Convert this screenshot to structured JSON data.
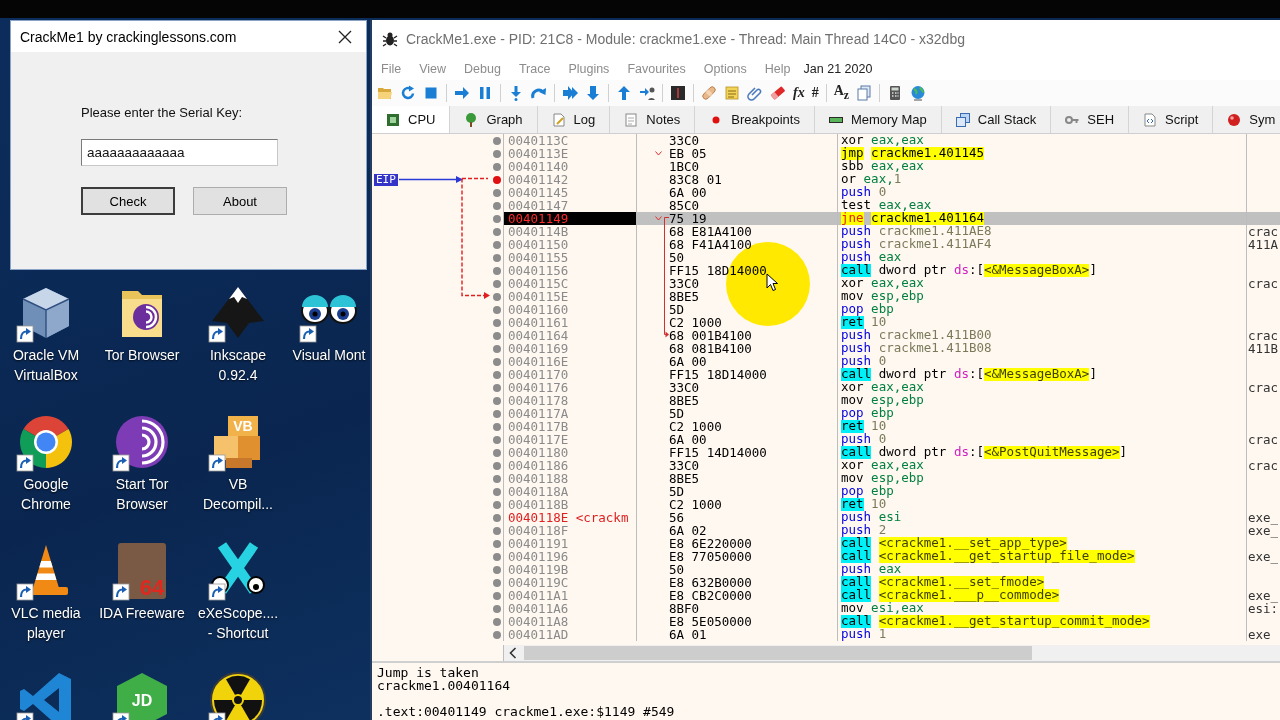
{
  "dialog": {
    "title": "CrackMe1 by crackinglessons.com",
    "prompt": "Please enter the Serial Key:",
    "serial_value": "aaaaaaaaaaaaa",
    "buttons": [
      {
        "label": "Check",
        "default": true
      },
      {
        "label": "About",
        "default": false
      }
    ]
  },
  "desktop": {
    "icon_rows": [
      [
        {
          "kind": "cube",
          "label": "Oracle VM VirtualBox",
          "shortcut": true
        },
        {
          "kind": "folder",
          "label": "Tor Browser",
          "shortcut": false
        },
        {
          "kind": "mountain",
          "label": "Inkscape 0.92.4",
          "shortcut": true
        },
        {
          "kind": "eyes",
          "label": "Visual Mont",
          "shortcut": true
        }
      ],
      [
        {
          "kind": "tricolor",
          "label": "Google Chrome",
          "shortcut": true
        },
        {
          "kind": "onion",
          "label": "Start Tor Browser",
          "shortcut": true
        },
        {
          "kind": "boxes",
          "glyph": "VB",
          "label": "VB Decompil...",
          "shortcut": true
        }
      ],
      [
        {
          "kind": "cone",
          "label": "VLC media player",
          "shortcut": true
        },
        {
          "kind": "portrait",
          "glyph": "64",
          "label": "IDA Freeware",
          "shortcut": true
        },
        {
          "kind": "xeyes",
          "label": "eXeScope.... - Shortcut",
          "shortcut": true
        }
      ],
      [
        {
          "kind": "ribbon",
          "shortcut": true
        },
        {
          "kind": "hexagon",
          "glyph": "JD",
          "shortcut": true
        },
        {
          "kind": "radiation",
          "shortcut": true
        }
      ]
    ]
  },
  "debugger": {
    "title": "CrackMe1.exe - PID: 21C8 - Module: crackme1.exe - Thread: Main Thread 14C0 - x32dbg",
    "menu": [
      "File",
      "View",
      "Debug",
      "Trace",
      "Plugins",
      "Favourites",
      "Options",
      "Help"
    ],
    "build_date": "Jan 21 2020",
    "toolbar_glyphs": [
      "fx",
      "#",
      "A$_{z}$"
    ],
    "tabs": [
      {
        "label": "CPU",
        "selected": true
      },
      {
        "label": "Graph",
        "selected": false
      },
      {
        "label": "Log",
        "selected": false
      },
      {
        "label": "Notes",
        "selected": false
      },
      {
        "label": "Breakpoints",
        "selected": false
      },
      {
        "label": "Memory Map",
        "selected": false
      },
      {
        "label": "Call Stack",
        "selected": false
      },
      {
        "label": "SEH",
        "selected": false
      },
      {
        "label": "Script",
        "selected": false
      },
      {
        "label": "Sym",
        "selected": false
      }
    ],
    "disassembly": {
      "eip_label": "EIP",
      "rows": [
        {
          "address": "0040113C",
          "bytes": "33C0",
          "mnemonic": {
            "text": "xor",
            "kind": "plain"
          },
          "operands": [
            {
              "text": "eax,eax",
              "kind": "register"
            }
          ],
          "selected": false,
          "breakpoint": false,
          "eip": false,
          "jump_marker": false
        },
        {
          "address": "0040113E",
          "bytes": "EB 05",
          "mnemonic": {
            "text": "jmp",
            "kind": "jump"
          },
          "operands": [
            {
              "text": "crackme1.401145",
              "kind": "target"
            }
          ],
          "selected": false,
          "breakpoint": false,
          "eip": false,
          "jump_marker": true
        },
        {
          "address": "00401140",
          "bytes": "1BC0",
          "mnemonic": {
            "text": "sbb",
            "kind": "plain"
          },
          "operands": [
            {
              "text": "eax,eax",
              "kind": "register"
            }
          ],
          "selected": false,
          "breakpoint": false,
          "eip": false,
          "jump_marker": false
        },
        {
          "address": "00401142",
          "bytes": "83C8 01",
          "mnemonic": {
            "text": "or",
            "kind": "plain"
          },
          "operands": [
            {
              "text": "eax,",
              "kind": "register"
            },
            {
              "text": "1",
              "kind": "value"
            }
          ],
          "selected": false,
          "breakpoint": true,
          "eip": true,
          "jump_marker": false
        },
        {
          "address": "00401145",
          "bytes": "6A 00",
          "mnemonic": {
            "text": "push",
            "kind": "stack"
          },
          "operands": [
            {
              "text": "0",
              "kind": "value"
            }
          ],
          "selected": false,
          "breakpoint": false,
          "eip": false,
          "jump_marker": false
        },
        {
          "address": "00401147",
          "bytes": "85C0",
          "mnemonic": {
            "text": "test",
            "kind": "plain"
          },
          "operands": [
            {
              "text": "eax,eax",
              "kind": "register"
            }
          ],
          "selected": false,
          "breakpoint": false,
          "eip": false,
          "jump_marker": false
        },
        {
          "address": "00401149",
          "bytes": "75 19",
          "mnemonic": {
            "text": "jne",
            "kind": "cond-jump"
          },
          "operands": [
            {
              "text": "crackme1.401164",
              "kind": "target"
            }
          ],
          "selected": true,
          "breakpoint": false,
          "eip": false,
          "jump_marker": true
        },
        {
          "address": "0040114B",
          "bytes": "68 E81A4100",
          "mnemonic": {
            "text": "push",
            "kind": "stack"
          },
          "operands": [
            {
              "text": "crackme1.411AE8",
              "kind": "value"
            }
          ],
          "comment": "crac",
          "selected": false,
          "breakpoint": false,
          "eip": false,
          "jump_marker": false
        },
        {
          "address": "00401150",
          "bytes": "68 F41A4100",
          "mnemonic": {
            "text": "push",
            "kind": "stack"
          },
          "operands": [
            {
              "text": "crackme1.411AF4",
              "kind": "value"
            }
          ],
          "comment": "411A",
          "selected": false,
          "breakpoint": false,
          "eip": false,
          "jump_marker": false
        },
        {
          "address": "00401155",
          "bytes": "50",
          "mnemonic": {
            "text": "push",
            "kind": "stack"
          },
          "operands": [
            {
              "text": "eax",
              "kind": "register"
            }
          ],
          "selected": false,
          "breakpoint": false,
          "eip": false,
          "jump_marker": false
        },
        {
          "address": "00401156",
          "bytes": "FF15 18D14000",
          "mnemonic": {
            "text": "call",
            "kind": "call"
          },
          "operands": [
            {
              "text": "dword ptr ",
              "kind": "plain"
            },
            {
              "text": "ds",
              "kind": "segment"
            },
            {
              "text": ":[",
              "kind": "plain"
            },
            {
              "text": "<&MessageBoxA>",
              "kind": "symbol"
            },
            {
              "text": "]",
              "kind": "plain"
            }
          ],
          "selected": false,
          "breakpoint": false,
          "eip": false,
          "jump_marker": false
        },
        {
          "address": "0040115C",
          "bytes": "33C0",
          "mnemonic": {
            "text": "xor",
            "kind": "plain"
          },
          "operands": [
            {
              "text": "eax,eax",
              "kind": "register"
            }
          ],
          "comment": "crac",
          "selected": false,
          "breakpoint": false,
          "eip": false,
          "jump_marker": false
        },
        {
          "address": "0040115E",
          "bytes": "8BE5",
          "mnemonic": {
            "text": "mov",
            "kind": "plain"
          },
          "operands": [
            {
              "text": "esp,ebp",
              "kind": "register"
            }
          ],
          "selected": false,
          "breakpoint": false,
          "eip": false,
          "jump_marker": false
        },
        {
          "address": "00401160",
          "bytes": "5D",
          "mnemonic": {
            "text": "pop",
            "kind": "stack"
          },
          "operands": [
            {
              "text": "ebp",
              "kind": "register"
            }
          ],
          "selected": false,
          "breakpoint": false,
          "eip": false,
          "jump_marker": false
        },
        {
          "address": "00401161",
          "bytes": "C2 1000",
          "mnemonic": {
            "text": "ret",
            "kind": "call"
          },
          "operands": [
            {
              "text": "10",
              "kind": "value"
            }
          ],
          "selected": false,
          "breakpoint": false,
          "eip": false,
          "jump_marker": false
        },
        {
          "address": "00401164",
          "bytes": "68 001B4100",
          "mnemonic": {
            "text": "push",
            "kind": "stack"
          },
          "operands": [
            {
              "text": "crackme1.411B00",
              "kind": "value"
            }
          ],
          "comment": "crac",
          "selected": false,
          "breakpoint": false,
          "eip": false,
          "jump_marker": false
        },
        {
          "address": "00401169",
          "bytes": "68 081B4100",
          "mnemonic": {
            "text": "push",
            "kind": "stack"
          },
          "operands": [
            {
              "text": "crackme1.411B08",
              "kind": "value"
            }
          ],
          "comment": "411B",
          "selected": false,
          "breakpoint": false,
          "eip": false,
          "jump_marker": false
        },
        {
          "address": "0040116E",
          "bytes": "6A 00",
          "mnemonic": {
            "text": "push",
            "kind": "stack"
          },
          "operands": [
            {
              "text": "0",
              "kind": "value"
            }
          ],
          "selected": false,
          "breakpoint": false,
          "eip": false,
          "jump_marker": false
        },
        {
          "address": "00401170",
          "bytes": "FF15 18D14000",
          "mnemonic": {
            "text": "call",
            "kind": "call"
          },
          "operands": [
            {
              "text": "dword ptr ",
              "kind": "plain"
            },
            {
              "text": "ds",
              "kind": "segment"
            },
            {
              "text": ":[",
              "kind": "plain"
            },
            {
              "text": "<&MessageBoxA>",
              "kind": "symbol"
            },
            {
              "text": "]",
              "kind": "plain"
            }
          ],
          "selected": false,
          "breakpoint": false,
          "eip": false,
          "jump_marker": false
        },
        {
          "address": "00401176",
          "bytes": "33C0",
          "mnemonic": {
            "text": "xor",
            "kind": "plain"
          },
          "operands": [
            {
              "text": "eax,eax",
              "kind": "register"
            }
          ],
          "comment": "crac",
          "selected": false,
          "breakpoint": false,
          "eip": false,
          "jump_marker": false
        },
        {
          "address": "00401178",
          "bytes": "8BE5",
          "mnemonic": {
            "text": "mov",
            "kind": "plain"
          },
          "operands": [
            {
              "text": "esp,ebp",
              "kind": "register"
            }
          ],
          "selected": false,
          "breakpoint": false,
          "eip": false,
          "jump_marker": false
        },
        {
          "address": "0040117A",
          "bytes": "5D",
          "mnemonic": {
            "text": "pop",
            "kind": "stack"
          },
          "operands": [
            {
              "text": "ebp",
              "kind": "register"
            }
          ],
          "selected": false,
          "breakpoint": false,
          "eip": false,
          "jump_marker": false
        },
        {
          "address": "0040117B",
          "bytes": "C2 1000",
          "mnemonic": {
            "text": "ret",
            "kind": "call"
          },
          "operands": [
            {
              "text": "10",
              "kind": "value"
            }
          ],
          "selected": false,
          "breakpoint": false,
          "eip": false,
          "jump_marker": false
        },
        {
          "address": "0040117E",
          "bytes": "6A 00",
          "mnemonic": {
            "text": "push",
            "kind": "stack"
          },
          "operands": [
            {
              "text": "0",
              "kind": "value"
            }
          ],
          "comment": "crac",
          "selected": false,
          "breakpoint": false,
          "eip": false,
          "jump_marker": false
        },
        {
          "address": "00401180",
          "bytes": "FF15 14D14000",
          "mnemonic": {
            "text": "call",
            "kind": "call"
          },
          "operands": [
            {
              "text": "dword ptr ",
              "kind": "plain"
            },
            {
              "text": "ds",
              "kind": "segment"
            },
            {
              "text": ":[",
              "kind": "plain"
            },
            {
              "text": "<&PostQuitMessage>",
              "kind": "symbol"
            },
            {
              "text": "]",
              "kind": "plain"
            }
          ],
          "selected": false,
          "breakpoint": false,
          "eip": false,
          "jump_marker": false
        },
        {
          "address": "00401186",
          "bytes": "33C0",
          "mnemonic": {
            "text": "xor",
            "kind": "plain"
          },
          "operands": [
            {
              "text": "eax,eax",
              "kind": "register"
            }
          ],
          "comment": "crac",
          "selected": false,
          "breakpoint": false,
          "eip": false,
          "jump_marker": false
        },
        {
          "address": "00401188",
          "bytes": "8BE5",
          "mnemonic": {
            "text": "mov",
            "kind": "plain"
          },
          "operands": [
            {
              "text": "esp,ebp",
              "kind": "register"
            }
          ],
          "selected": false,
          "breakpoint": false,
          "eip": false,
          "jump_marker": false
        },
        {
          "address": "0040118A",
          "bytes": "5D",
          "mnemonic": {
            "text": "pop",
            "kind": "stack"
          },
          "operands": [
            {
              "text": "ebp",
              "kind": "register"
            }
          ],
          "selected": false,
          "breakpoint": false,
          "eip": false,
          "jump_marker": false
        },
        {
          "address": "0040118B",
          "bytes": "C2 1000",
          "mnemonic": {
            "text": "ret",
            "kind": "call"
          },
          "operands": [
            {
              "text": "10",
              "kind": "value"
            }
          ],
          "selected": false,
          "breakpoint": false,
          "eip": false,
          "jump_marker": false
        },
        {
          "address": "0040118E",
          "label": "<crackm",
          "bytes": "56",
          "mnemonic": {
            "text": "push",
            "kind": "stack"
          },
          "operands": [
            {
              "text": "esi",
              "kind": "register"
            }
          ],
          "comment": "exe_",
          "selected": false,
          "breakpoint": false,
          "eip": false,
          "jump_marker": false
        },
        {
          "address": "0040118F",
          "bytes": "6A 02",
          "mnemonic": {
            "text": "push",
            "kind": "stack"
          },
          "operands": [
            {
              "text": "2",
              "kind": "value"
            }
          ],
          "comment": "exe_",
          "selected": false,
          "breakpoint": false,
          "eip": false,
          "jump_marker": false
        },
        {
          "address": "00401191",
          "bytes": "E8 6E220000",
          "mnemonic": {
            "text": "call",
            "kind": "call"
          },
          "operands": [
            {
              "text": "<crackme1.__set_app_type>",
              "kind": "symbol"
            }
          ],
          "selected": false,
          "breakpoint": false,
          "eip": false,
          "jump_marker": false
        },
        {
          "address": "00401196",
          "bytes": "E8 77050000",
          "mnemonic": {
            "text": "call",
            "kind": "call"
          },
          "operands": [
            {
              "text": "<crackme1.__get_startup_file_mode>",
              "kind": "symbol"
            }
          ],
          "comment": "exe_",
          "selected": false,
          "breakpoint": false,
          "eip": false,
          "jump_marker": false
        },
        {
          "address": "0040119B",
          "bytes": "50",
          "mnemonic": {
            "text": "push",
            "kind": "stack"
          },
          "operands": [
            {
              "text": "eax",
              "kind": "register"
            }
          ],
          "selected": false,
          "breakpoint": false,
          "eip": false,
          "jump_marker": false
        },
        {
          "address": "0040119C",
          "bytes": "E8 632B0000",
          "mnemonic": {
            "text": "call",
            "kind": "call"
          },
          "operands": [
            {
              "text": "<crackme1.__set_fmode>",
              "kind": "symbol"
            }
          ],
          "selected": false,
          "breakpoint": false,
          "eip": false,
          "jump_marker": false
        },
        {
          "address": "004011A1",
          "bytes": "E8 CB2C0000",
          "mnemonic": {
            "text": "call",
            "kind": "call"
          },
          "operands": [
            {
              "text": "<crackme1.___p__commode>",
              "kind": "symbol"
            }
          ],
          "comment": "exe_",
          "selected": false,
          "breakpoint": false,
          "eip": false,
          "jump_marker": false
        },
        {
          "address": "004011A6",
          "bytes": "8BF0",
          "mnemonic": {
            "text": "mov",
            "kind": "plain"
          },
          "operands": [
            {
              "text": "esi,eax",
              "kind": "register"
            }
          ],
          "comment": "esi:",
          "selected": false,
          "breakpoint": false,
          "eip": false,
          "jump_marker": false
        },
        {
          "address": "004011A8",
          "bytes": "E8 5E050000",
          "mnemonic": {
            "text": "call",
            "kind": "call"
          },
          "operands": [
            {
              "text": "<crackme1.__get_startup_commit_mode>",
              "kind": "symbol"
            }
          ],
          "selected": false,
          "breakpoint": false,
          "eip": false,
          "jump_marker": false
        },
        {
          "address": "004011AD",
          "bytes": "6A 01",
          "mnemonic": {
            "text": "push",
            "kind": "stack"
          },
          "operands": [
            {
              "text": "1",
              "kind": "value"
            }
          ],
          "comment": "exe",
          "selected": false,
          "breakpoint": false,
          "eip": false,
          "jump_marker": false
        }
      ]
    },
    "info": {
      "lines": [
        "Jump is taken",
        "crackme1.00401164"
      ],
      "location": ".text:00401149 crackme1.exe:$1149 #549"
    }
  }
}
